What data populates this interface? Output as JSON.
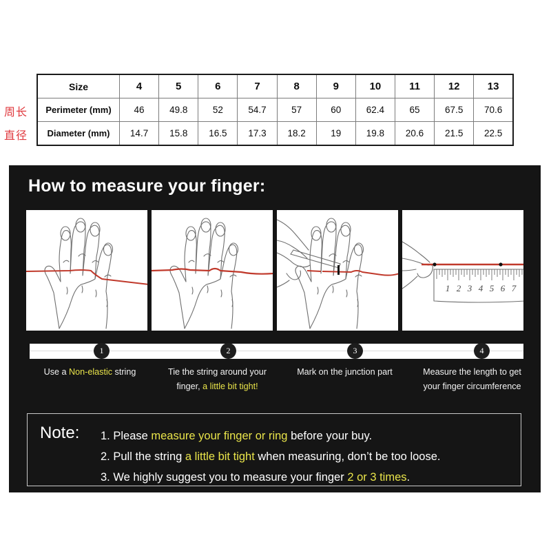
{
  "table": {
    "columns": [
      "Size",
      "4",
      "5",
      "6",
      "7",
      "8",
      "9",
      "10",
      "11",
      "12",
      "13"
    ],
    "rows": [
      {
        "label": "Perimeter (mm)",
        "side_label": "周长",
        "values": [
          "46",
          "49.8",
          "52",
          "54.7",
          "57",
          "60",
          "62.4",
          "65",
          "67.5",
          "70.6"
        ]
      },
      {
        "label": "Diameter (mm)",
        "side_label": "直径",
        "values": [
          "14.7",
          "15.8",
          "16.5",
          "17.3",
          "18.2",
          "19",
          "19.8",
          "20.6",
          "21.5",
          "22.5"
        ]
      }
    ]
  },
  "panel": {
    "title": "How to measure your finger:",
    "illustrations": [
      {
        "name": "hand-with-string-panel",
        "ruler_numbers": []
      },
      {
        "name": "hand-string-tied-panel",
        "ruler_numbers": []
      },
      {
        "name": "hand-marking-pen-panel",
        "ruler_numbers": []
      },
      {
        "name": "ruler-measuring-panel",
        "ruler_numbers": [
          "1",
          "2",
          "3",
          "4",
          "5",
          "6",
          "7"
        ]
      }
    ],
    "steps": [
      {
        "number": "1",
        "lines": [
          [
            {
              "t": "Use a ",
              "hl": false
            },
            {
              "t": "Non-elastic",
              "hl": true
            },
            {
              "t": " string",
              "hl": false
            }
          ]
        ]
      },
      {
        "number": "2",
        "lines": [
          [
            {
              "t": "Tie the string around your",
              "hl": false
            }
          ],
          [
            {
              "t": "finger, ",
              "hl": false
            },
            {
              "t": "a little bit tight!",
              "hl": true
            }
          ]
        ]
      },
      {
        "number": "3",
        "lines": [
          [
            {
              "t": "Mark on the junction part",
              "hl": false
            }
          ]
        ]
      },
      {
        "number": "4",
        "lines": [
          [
            {
              "t": "Measure the length to get",
              "hl": false
            }
          ],
          [
            {
              "t": "your finger circumference",
              "hl": false
            }
          ]
        ]
      }
    ],
    "note": {
      "label": "Note:",
      "items": [
        [
          {
            "t": "1. Please ",
            "hl": false
          },
          {
            "t": "measure your finger or ring",
            "hl": true
          },
          {
            "t": " before your buy.",
            "hl": false
          }
        ],
        [
          {
            "t": "2. Pull the string ",
            "hl": false
          },
          {
            "t": "a little bit tight",
            "hl": true
          },
          {
            "t": " when measuring, don’t be too loose.",
            "hl": false
          }
        ],
        [
          {
            "t": "3. We highly suggest you to measure your finger ",
            "hl": false
          },
          {
            "t": "2 or 3 times",
            "hl": true
          },
          {
            "t": ".",
            "hl": false
          }
        ]
      ]
    }
  },
  "colors": {
    "panel_background": "#151515",
    "highlight_yellow": "#e9e44a",
    "string_red": "#c0392b",
    "cn_label_red": "#e0393e",
    "table_border": "#7b7b7b"
  }
}
